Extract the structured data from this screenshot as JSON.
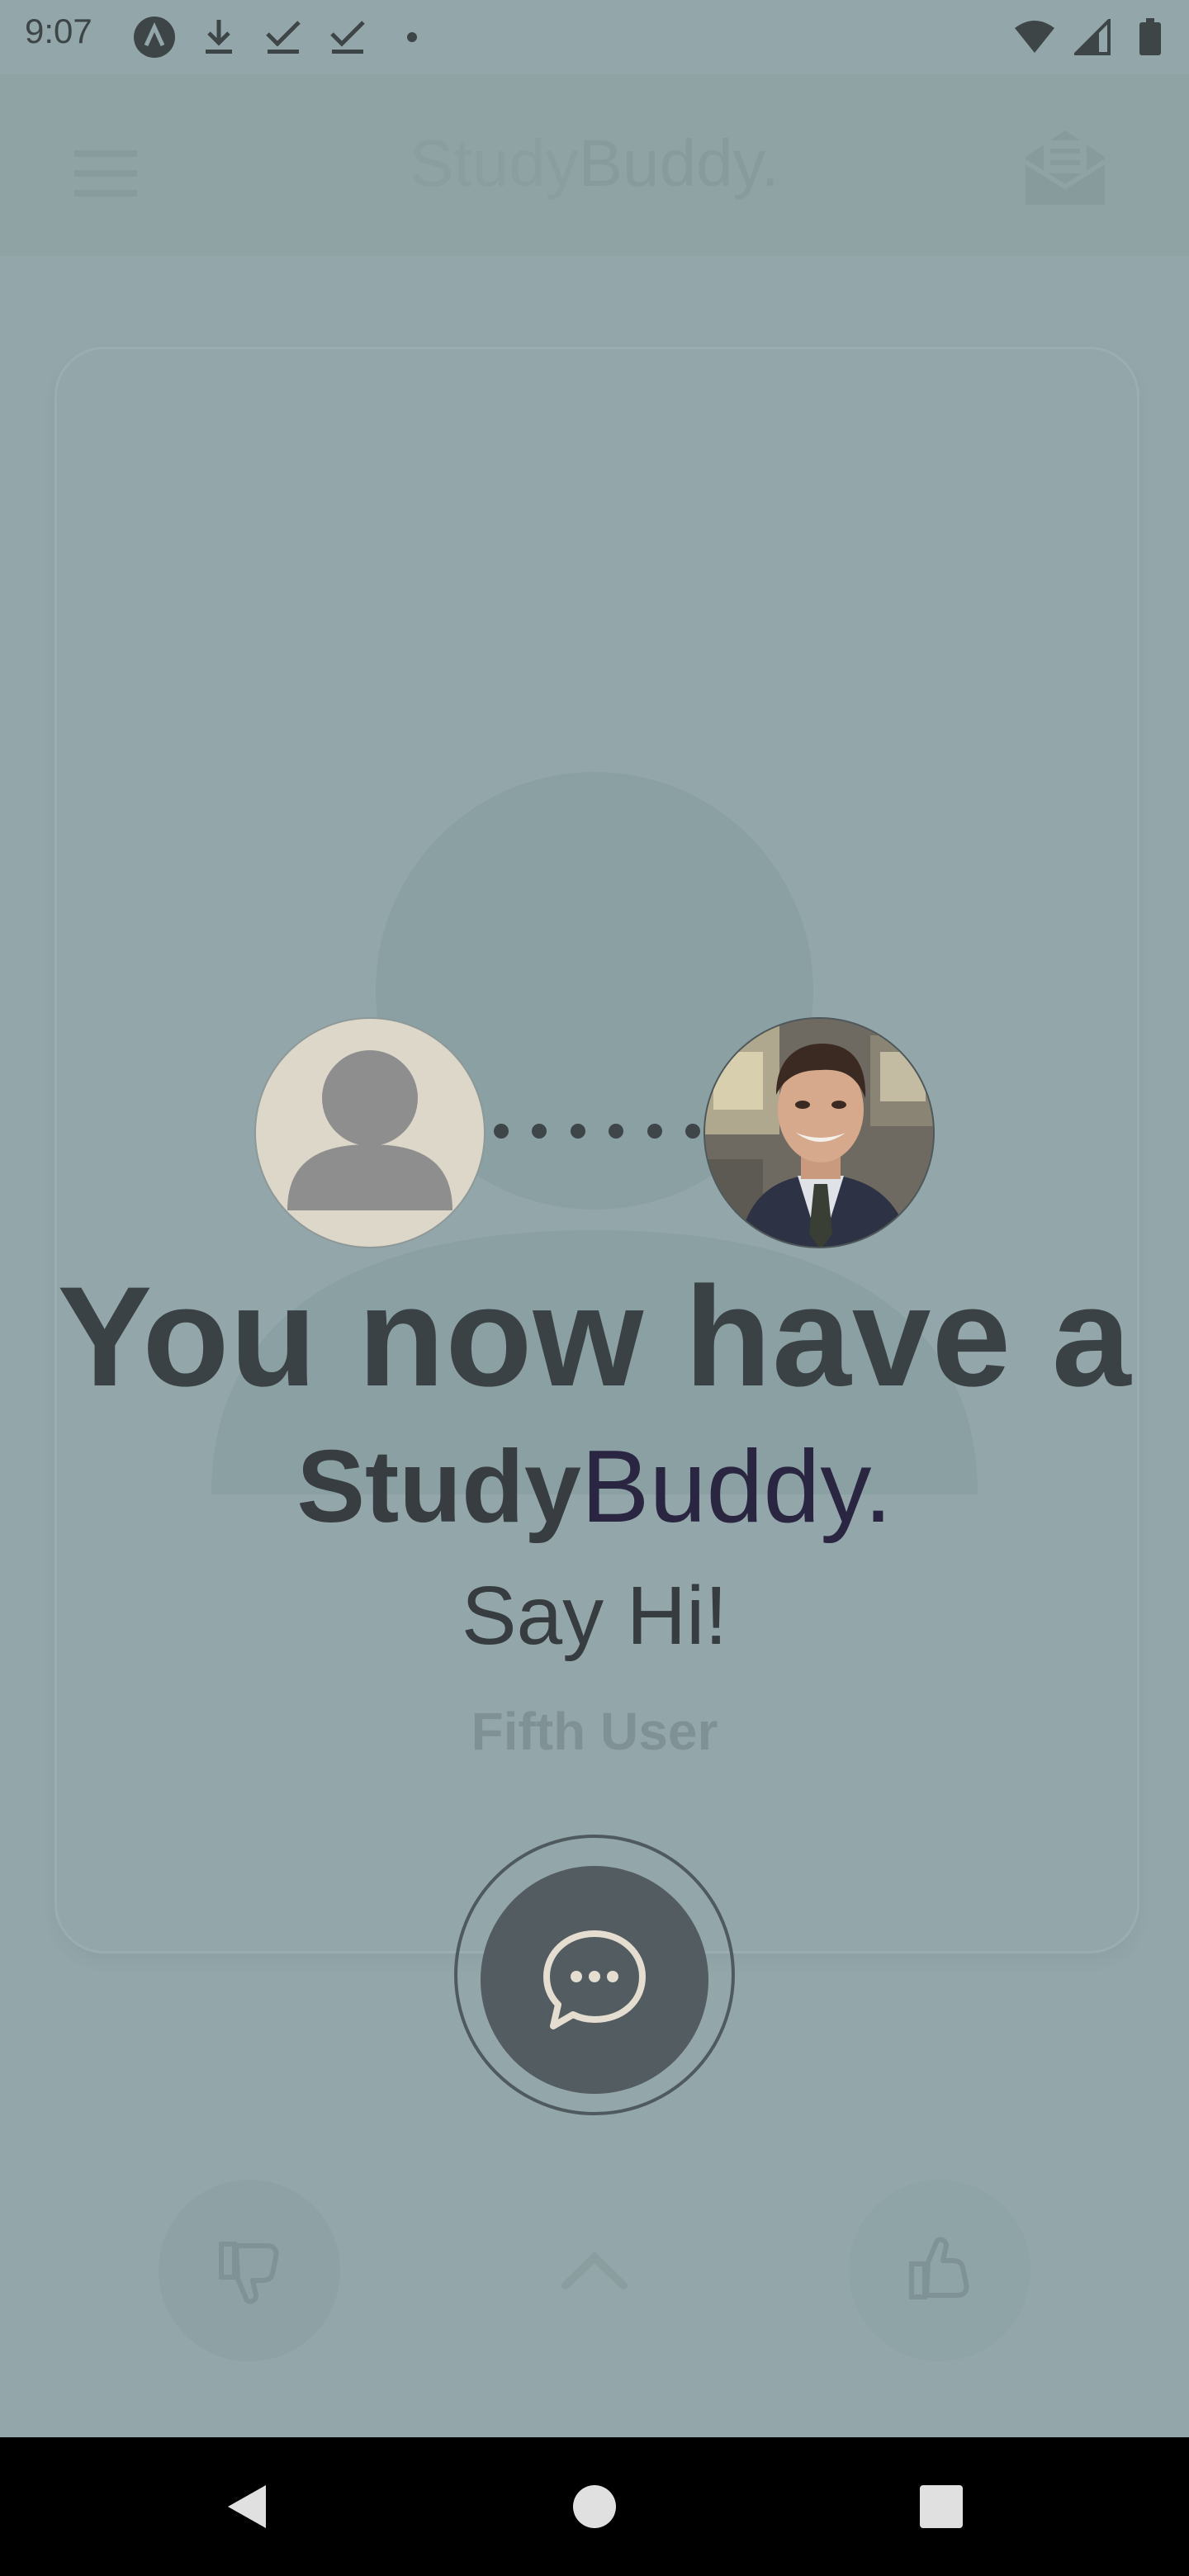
{
  "status_bar": {
    "time": "9:07",
    "left_icons": [
      "app-a-icon",
      "download-icon",
      "check-icon",
      "check-icon",
      "dot-icon"
    ],
    "right_icons": [
      "wifi-icon",
      "signal-icon",
      "battery-icon"
    ]
  },
  "app_bar": {
    "brand_part1": "Study",
    "brand_part2": "Buddy."
  },
  "card": {
    "user_name": "Fifth User"
  },
  "match": {
    "headline": "You now have a",
    "brand_part1": "Study",
    "brand_part2": "Buddy.",
    "subtitle": "Say Hi!"
  },
  "actions": [
    "dislike-button",
    "expand-button",
    "like-button"
  ],
  "colors": {
    "scrim": "#93a7aa",
    "text_dark": "#3b4245",
    "brand_accent": "#2a2540",
    "chat_button": "#525c61",
    "avatar_placeholder": "#dcd7c9"
  }
}
